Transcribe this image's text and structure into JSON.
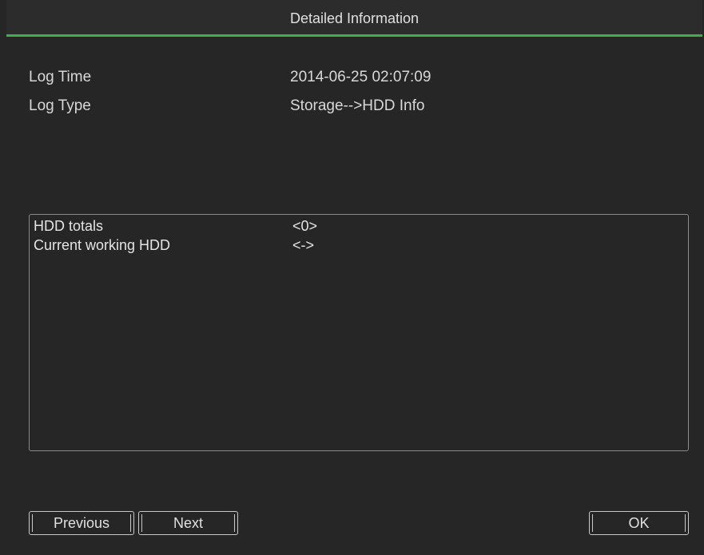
{
  "dialog": {
    "title": "Detailed Information"
  },
  "fields": [
    {
      "label": "Log Time",
      "value": "2014-06-25 02:07:09"
    },
    {
      "label": "Log Type",
      "value": "Storage-->HDD Info"
    }
  ],
  "details": [
    {
      "key": "HDD totals",
      "value": "<0>"
    },
    {
      "key": "Current working HDD",
      "value": "<->"
    }
  ],
  "buttons": {
    "previous": "Previous",
    "next": "Next",
    "ok": "OK"
  },
  "colors": {
    "background": "#262626",
    "accent": "#3fae49",
    "text": "#d8d8d8"
  }
}
